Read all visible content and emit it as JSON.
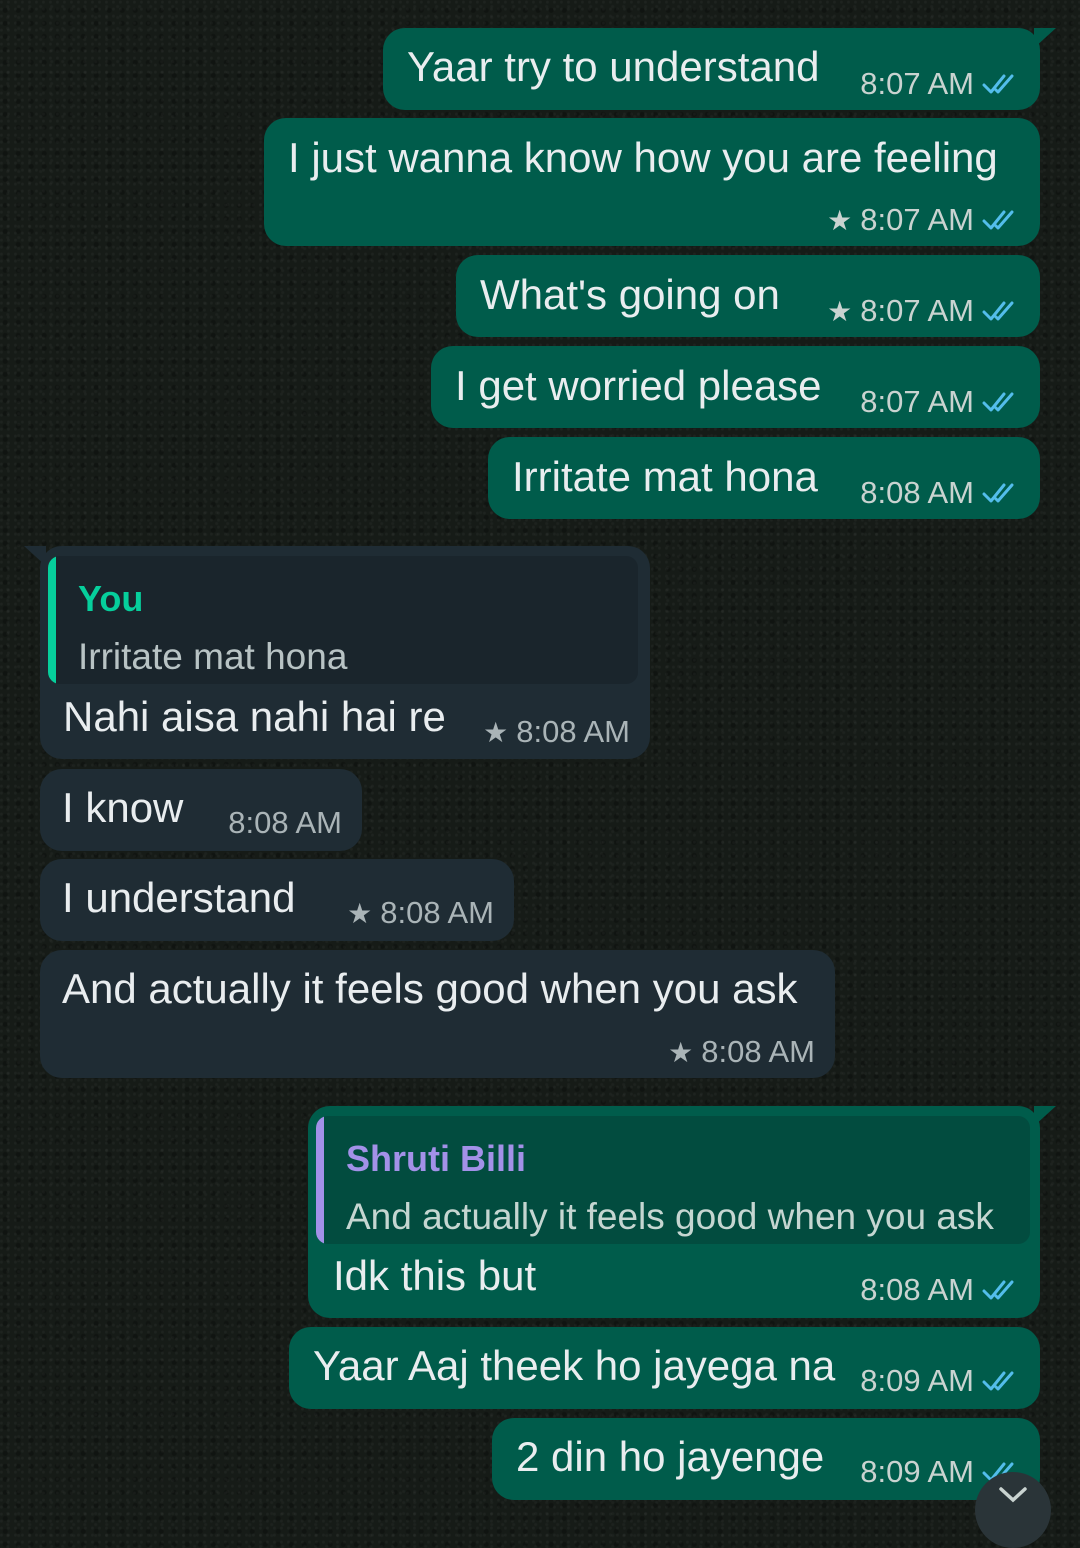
{
  "conversation": {
    "messages": [
      {
        "direction": "outgoing",
        "text": "Yaar try to understand",
        "time": "8:07 AM",
        "starred": false,
        "read": true
      },
      {
        "direction": "outgoing",
        "text": "I just wanna know how you are feeling",
        "time": "8:07 AM",
        "starred": true,
        "read": true
      },
      {
        "direction": "outgoing",
        "text": "What's going on",
        "time": "8:07 AM",
        "starred": true,
        "read": true
      },
      {
        "direction": "outgoing",
        "text": "I get worried please",
        "time": "8:07 AM",
        "starred": false,
        "read": true
      },
      {
        "direction": "outgoing",
        "text": "Irritate mat hona",
        "time": "8:08 AM",
        "starred": false,
        "read": true
      },
      {
        "direction": "incoming",
        "text": "Nahi aisa nahi hai re",
        "time": "8:08 AM",
        "starred": true,
        "reply_to": {
          "sender": "You",
          "text": "Irritate mat hona"
        }
      },
      {
        "direction": "incoming",
        "text": "I know",
        "time": "8:08 AM",
        "starred": false
      },
      {
        "direction": "incoming",
        "text": "I understand",
        "time": "8:08 AM",
        "starred": true
      },
      {
        "direction": "incoming",
        "text": "And actually it feels good when you ask",
        "time": "8:08 AM",
        "starred": true
      },
      {
        "direction": "outgoing",
        "text": "Idk this but",
        "time": "8:08 AM",
        "starred": false,
        "read": true,
        "reply_to": {
          "sender": "Shruti Billi",
          "text": "And actually it feels good when you ask"
        }
      },
      {
        "direction": "outgoing",
        "text": "Yaar Aaj theek ho jayega na",
        "time": "8:09 AM",
        "starred": false,
        "read": true
      },
      {
        "direction": "outgoing",
        "text": "2 din ho jayenge",
        "time": "8:09 AM",
        "starred": false,
        "read": true
      }
    ]
  },
  "icons": {
    "star": "star-icon",
    "read_receipt": "double-check-icon",
    "scroll_down": "chevron-down-icon"
  },
  "colors": {
    "outgoing_bubble": "#005c4b",
    "incoming_bubble": "#1f2c34",
    "read_tick": "#53bdeb",
    "quote_you": "#06cf9c",
    "quote_contact": "#a391e8"
  }
}
